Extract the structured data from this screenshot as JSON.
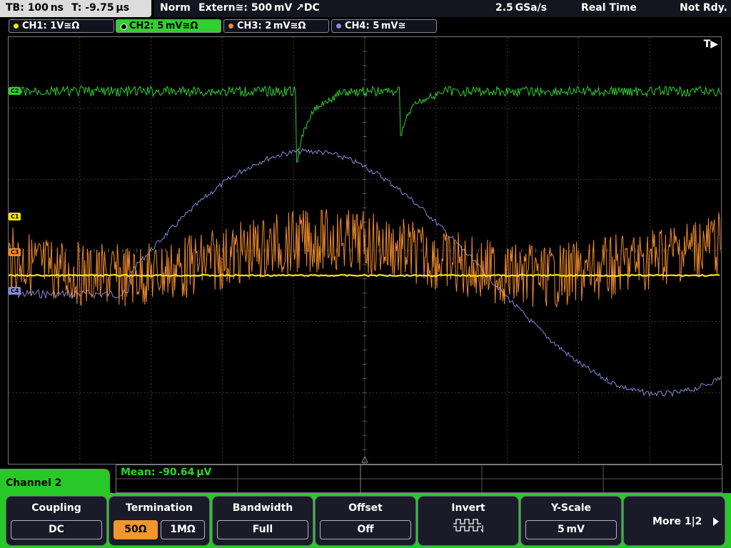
{
  "status_bar": {
    "timebase": "TB: 100 ns",
    "trigger_time": "T: -9.75 µs",
    "trigger_mode": "Norm",
    "trigger_source": "Extern≅: 500 mV ↗DC",
    "sample_rate": "2.5 GSa/s",
    "acquisition_mode": "Real Time",
    "run_state": "Not Rdy."
  },
  "channels": [
    {
      "id": "ch1",
      "label": "CH1: 1V≅Ω",
      "color": "#f5e600",
      "active": false,
      "marker": "C1"
    },
    {
      "id": "ch2",
      "label": "CH2: 5 mV≅Ω",
      "color": "#2fd02f",
      "active": true,
      "marker": "C2"
    },
    {
      "id": "ch3",
      "label": "CH3: 2 mV≅Ω",
      "color": "#f08a2a",
      "active": false,
      "marker": "C3"
    },
    {
      "id": "ch4",
      "label": "CH4: 5 mV≅",
      "color": "#8888dd",
      "active": false,
      "marker": "C4"
    }
  ],
  "trigger_flag": "T▶",
  "measurement": {
    "label": "Mean: -90.64 µV"
  },
  "menu": {
    "title": "Channel 2",
    "coupling": {
      "title": "Coupling",
      "value": "DC"
    },
    "termination": {
      "title": "Termination",
      "options": [
        "50Ω",
        "1MΩ"
      ],
      "selected": "50Ω"
    },
    "bandwidth": {
      "title": "Bandwidth",
      "value": "Full"
    },
    "offset": {
      "title": "Offset",
      "value": "Off"
    },
    "invert": {
      "title": "Invert",
      "icon": "invert-square-wave-icon"
    },
    "yscale": {
      "title": "Y-Scale",
      "value": "5 mV"
    },
    "more": {
      "label": "More 1|2",
      "icon": "arrow-right-icon"
    }
  },
  "colors": {
    "grid": "#3a3a3a",
    "accent": "#28c828",
    "active_option": "#f0962c"
  }
}
